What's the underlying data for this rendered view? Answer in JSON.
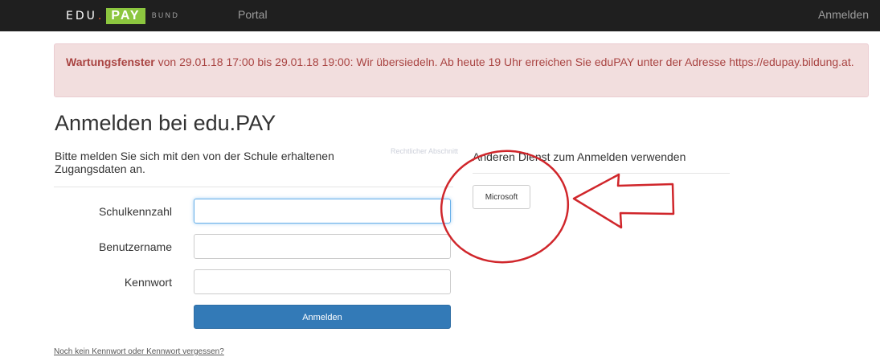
{
  "navbar": {
    "logo": {
      "part1": "EDU",
      "dot": ".",
      "part2": "PAY",
      "part3": "BUND"
    },
    "portal_label": "Portal",
    "login_label": "Anmelden"
  },
  "alert": {
    "bold": "Wartungsfenster",
    "text": " von 29.01.18 17:00 bis 29.01.18 19:00: Wir übersiedeln. Ab heute 19 Uhr erreichen Sie eduPAY unter der Adresse https://edupay.bildung.at."
  },
  "page": {
    "title": "Anmelden bei edu.PAY",
    "intro": "Bitte melden Sie sich mit den von der Schule erhaltenen Zugangsdaten an.",
    "faded_label": "Rechtlicher Abschnitt"
  },
  "form": {
    "school_label": "Schulkennzahl",
    "username_label": "Benutzername",
    "password_label": "Kennwort",
    "school_value": "",
    "username_value": "",
    "password_value": "",
    "submit_label": "Anmelden",
    "forgot_link": "Noch kein Kennwort oder Kennwort vergessen?"
  },
  "alternative": {
    "title": "Anderen Dienst zum Anmelden verwenden",
    "microsoft_button": "Microsoft"
  },
  "colors": {
    "navbar_bg": "#1f1f1f",
    "logo_green": "#8cc63f",
    "logo_dot": "#e8512a",
    "alert_bg": "#f2dede",
    "alert_text": "#a94442",
    "primary": "#337ab7",
    "annotation_red": "#d0262b"
  }
}
